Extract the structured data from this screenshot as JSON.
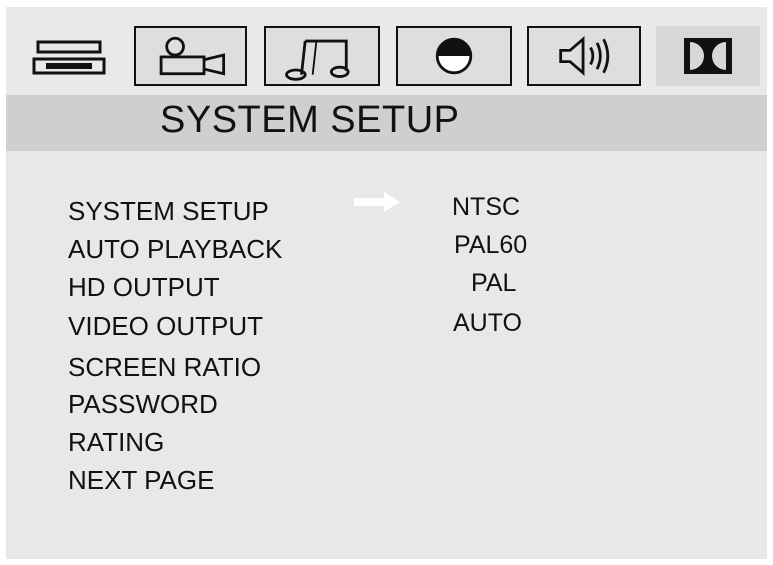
{
  "tabs": [
    {
      "name": "general-tab",
      "icon": "dvd-player-icon"
    },
    {
      "name": "camera-tab",
      "icon": "camera-icon"
    },
    {
      "name": "music-tab",
      "icon": "music-note-icon"
    },
    {
      "name": "display-tab",
      "icon": "half-circle-icon"
    },
    {
      "name": "audio-tab",
      "icon": "speaker-icon"
    },
    {
      "name": "dolby-tab",
      "icon": "dolby-logo-icon"
    }
  ],
  "header": {
    "title": "SYSTEM SETUP"
  },
  "menu": {
    "items": [
      "SYSTEM SETUP",
      "AUTO PLAYBACK",
      "HD OUTPUT",
      "VIDEO OUTPUT",
      "SCREEN RATIO",
      "PASSWORD",
      "RATING",
      "NEXT PAGE"
    ],
    "selected_index": 0
  },
  "options": {
    "items": [
      "NTSC",
      "PAL60",
      "PAL",
      "AUTO"
    ]
  },
  "colors": {
    "background": "#e8e8e8",
    "title_bar": "#cfcfcf",
    "text": "#111111",
    "arrow": "#ffffff"
  }
}
